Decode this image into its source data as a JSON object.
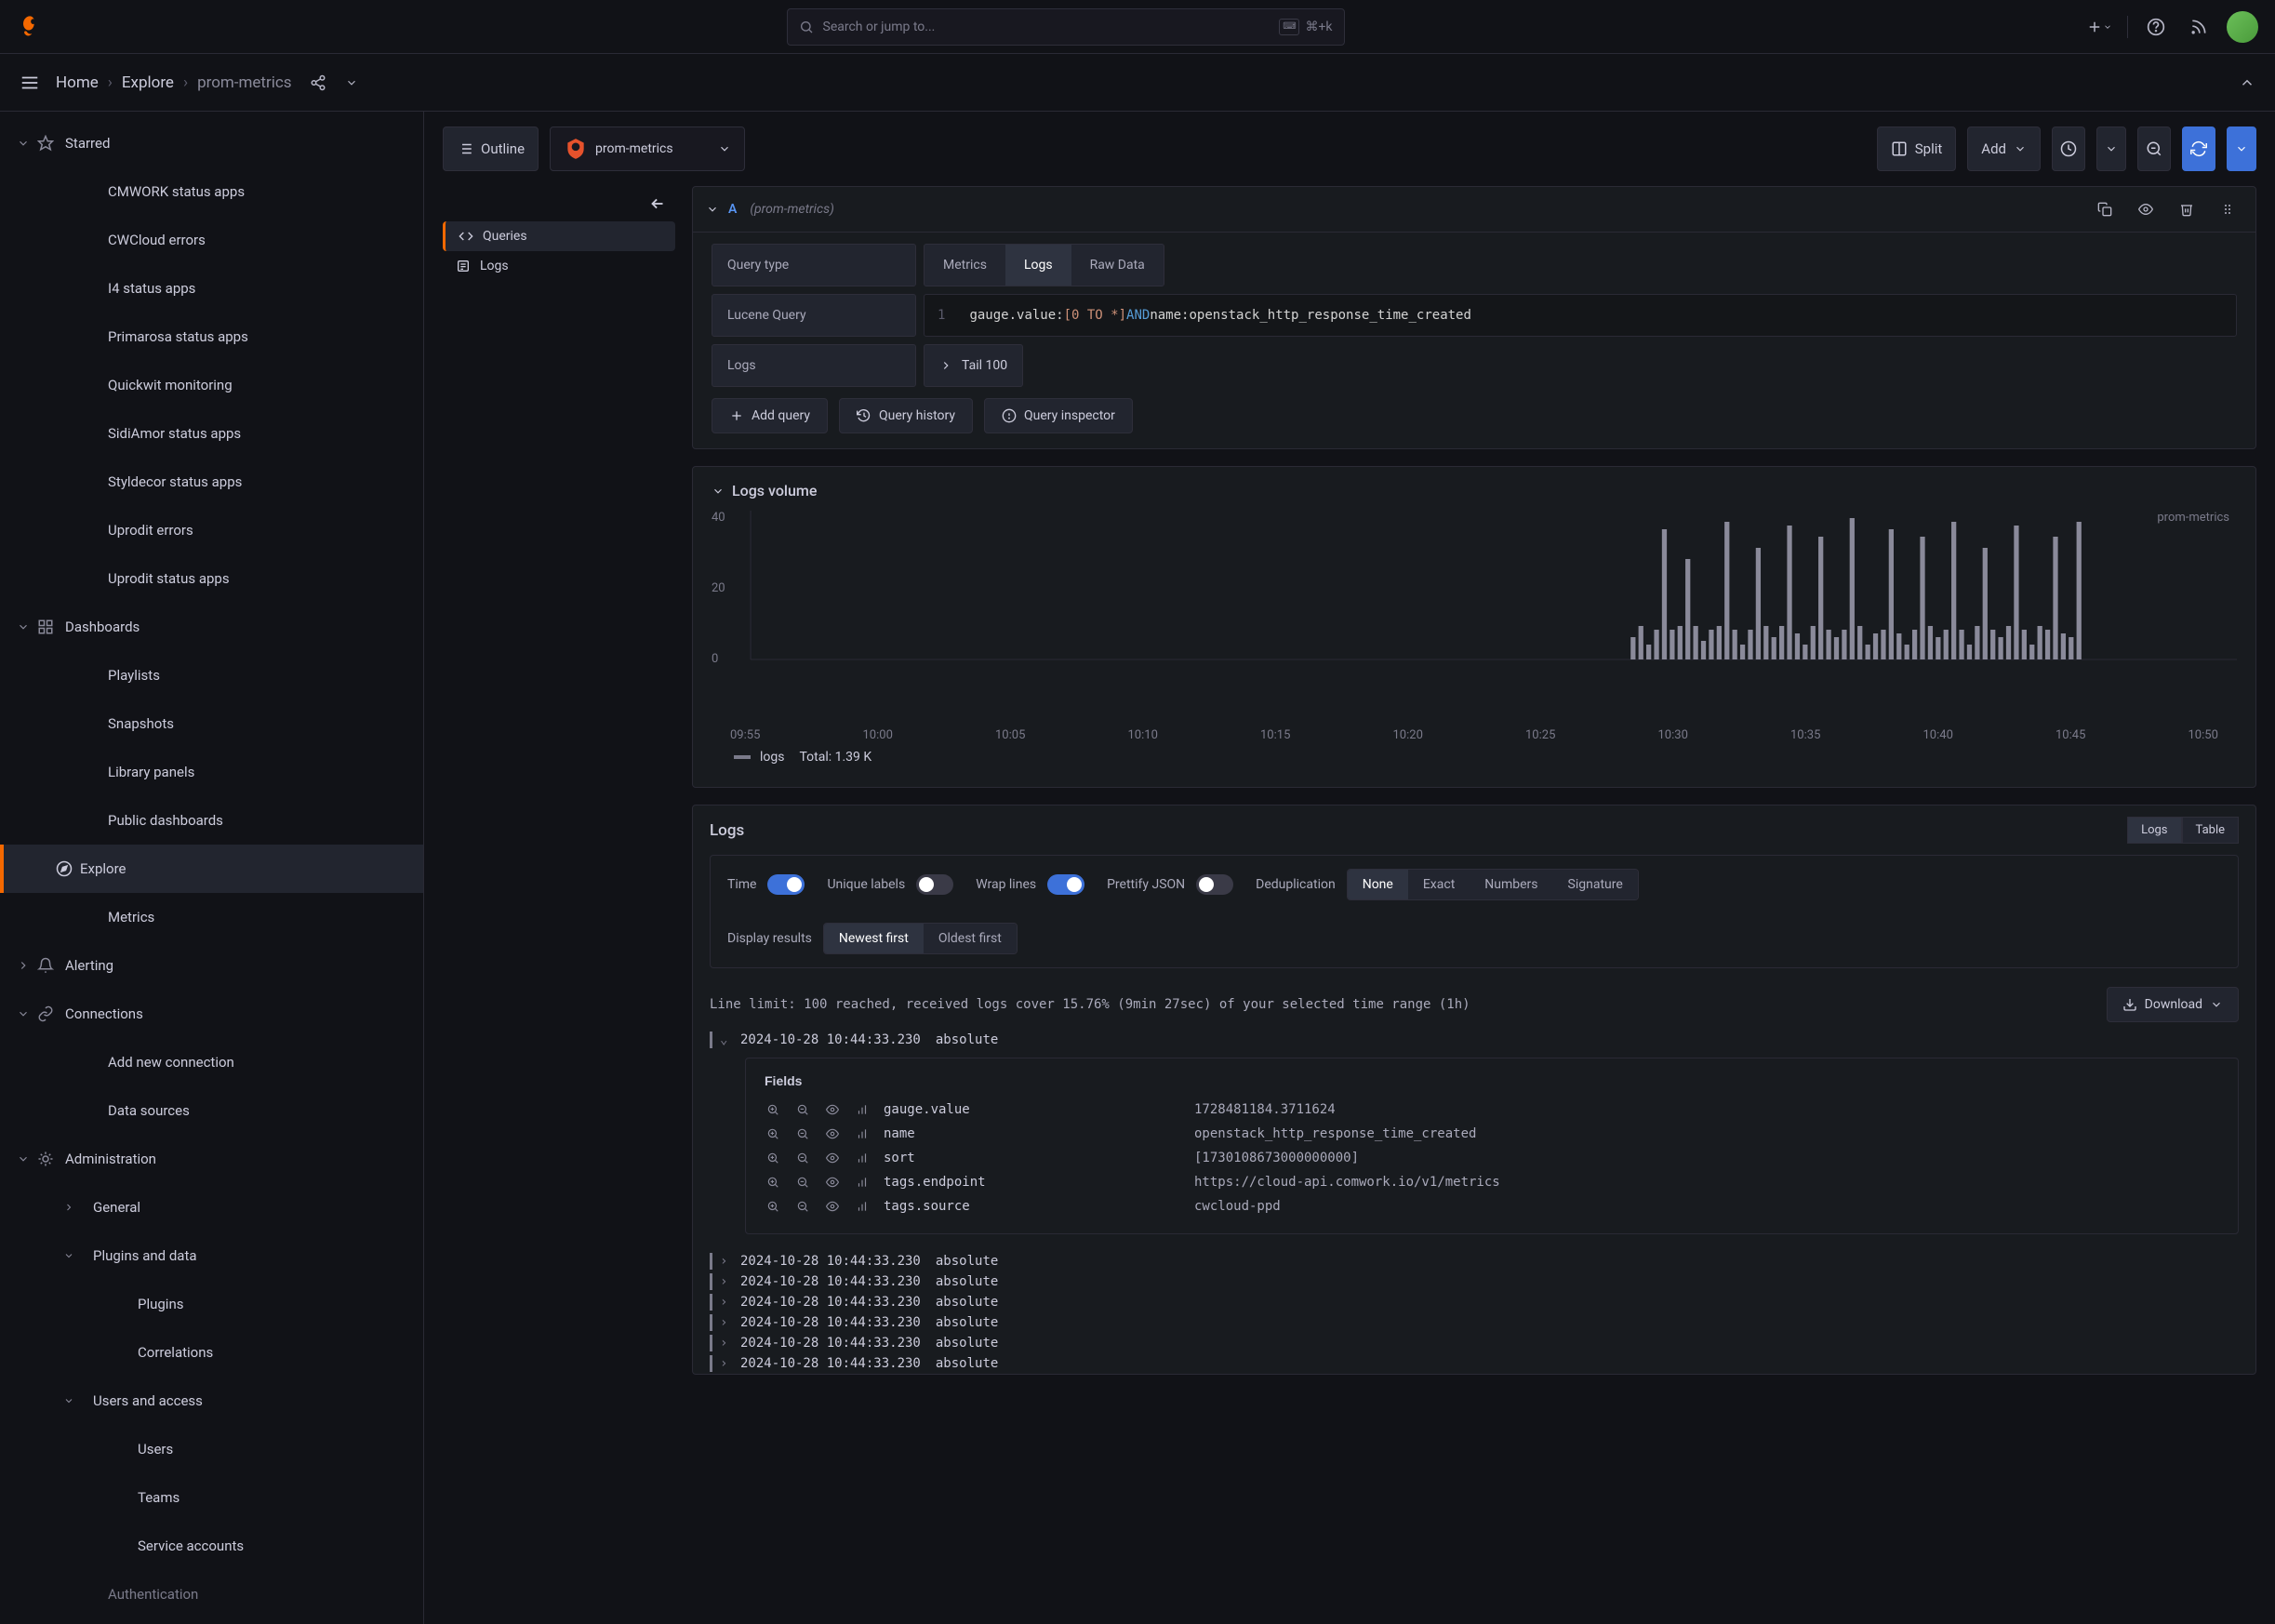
{
  "top": {
    "search_placeholder": "Search or jump to...",
    "kbd_shortcut": "⌘+k"
  },
  "breadcrumb": {
    "home": "Home",
    "explore": "Explore",
    "current": "prom-metrics"
  },
  "sidebar": {
    "starred": "Starred",
    "starred_items": [
      "CMWORK status apps",
      "CWCloud errors",
      "I4 status apps",
      "Primarosa status apps",
      "Quickwit monitoring",
      "SidiAmor status apps",
      "Styldecor status apps",
      "Uprodit errors",
      "Uprodit status apps"
    ],
    "dashboards": "Dashboards",
    "dashboards_items": [
      "Playlists",
      "Snapshots",
      "Library panels",
      "Public dashboards"
    ],
    "explore": "Explore",
    "explore_items": [
      "Metrics"
    ],
    "alerting": "Alerting",
    "connections": "Connections",
    "connections_items": [
      "Add new connection",
      "Data sources"
    ],
    "administration": "Administration",
    "admin_items": {
      "general": "General",
      "plugins": "Plugins and data",
      "plugins_children": [
        "Plugins",
        "Correlations"
      ],
      "users": "Users and access",
      "users_children": [
        "Users",
        "Teams",
        "Service accounts"
      ],
      "auth": "Authentication"
    }
  },
  "toolbar": {
    "outline": "Outline",
    "datasource": "prom-metrics",
    "split": "Split",
    "add": "Add"
  },
  "explore_tree": {
    "queries": "Queries",
    "logs": "Logs"
  },
  "query": {
    "letter": "A",
    "source": "(prom-metrics)",
    "type_label": "Query type",
    "types": [
      "Metrics",
      "Logs",
      "Raw Data"
    ],
    "lucene_label": "Lucene Query",
    "lucene_line": "1",
    "lucene_code_parts": {
      "p1": "gauge.value:",
      "p2": "[0 TO *]",
      "p3": " AND ",
      "p4": "name:openstack_http_response_time_created"
    },
    "logs_label": "Logs",
    "tail": "Tail 100"
  },
  "actions": {
    "add_query": "Add query",
    "history": "Query history",
    "inspector": "Query inspector"
  },
  "volume": {
    "title": "Logs volume",
    "legend": "logs",
    "total": "Total: 1.39 K",
    "series_label": "prom-metrics"
  },
  "chart_data": {
    "type": "bar",
    "title": "Logs volume",
    "ylabel": "",
    "ylim": [
      0,
      40
    ],
    "y_ticks": [
      0,
      20,
      40
    ],
    "categories": [
      "09:55",
      "10:00",
      "10:05",
      "10:10",
      "10:15",
      "10:20",
      "10:25",
      "10:30",
      "10:35",
      "10:40",
      "10:45",
      "10:50"
    ],
    "series": [
      {
        "name": "logs",
        "values_by_tick_segment": {
          "09:55-10:25": [],
          "10:28": [
            6,
            9,
            4,
            8,
            35,
            8,
            9,
            27,
            9,
            5,
            8,
            9,
            37,
            8,
            4,
            8,
            30,
            9,
            6,
            9,
            36,
            7,
            4,
            9,
            33,
            8,
            6,
            8,
            38,
            9,
            4,
            7,
            8,
            35,
            7,
            4,
            8,
            33,
            9,
            6,
            8,
            37,
            8,
            4,
            9,
            30,
            8,
            6,
            9,
            36,
            8,
            4,
            9,
            8,
            33,
            7,
            6,
            37
          ],
          "10:46-10:50": []
        }
      }
    ],
    "total": 1390
  },
  "logs_section": {
    "title": "Logs",
    "tabs": [
      "Logs",
      "Table"
    ],
    "opts": {
      "time": "Time",
      "unique": "Unique labels",
      "wrap": "Wrap lines",
      "prettify": "Prettify JSON",
      "dedup": "Deduplication",
      "dedup_options": [
        "None",
        "Exact",
        "Numbers",
        "Signature"
      ],
      "display": "Display results",
      "display_options": [
        "Newest first",
        "Oldest first"
      ]
    },
    "limit_text": "Line limit: 100 reached, received logs cover 15.76% (9min 27sec) of your selected time range (1h)",
    "download": "Download",
    "entries": [
      {
        "ts": "2024-10-28 10:44:33.230",
        "msg": "absolute",
        "expanded": true
      },
      {
        "ts": "2024-10-28 10:44:33.230",
        "msg": "absolute",
        "expanded": false
      },
      {
        "ts": "2024-10-28 10:44:33.230",
        "msg": "absolute",
        "expanded": false
      },
      {
        "ts": "2024-10-28 10:44:33.230",
        "msg": "absolute",
        "expanded": false
      },
      {
        "ts": "2024-10-28 10:44:33.230",
        "msg": "absolute",
        "expanded": false
      },
      {
        "ts": "2024-10-28 10:44:33.230",
        "msg": "absolute",
        "expanded": false
      },
      {
        "ts": "2024-10-28 10:44:33.230",
        "msg": "absolute",
        "expanded": false
      }
    ],
    "fields_header": "Fields",
    "fields": [
      {
        "name": "gauge.value",
        "value": "1728481184.3711624"
      },
      {
        "name": "name",
        "value": "openstack_http_response_time_created"
      },
      {
        "name": "sort",
        "value": "[1730108673000000000]"
      },
      {
        "name": "tags.endpoint",
        "value": "https://cloud-api.comwork.io/v1/metrics"
      },
      {
        "name": "tags.source",
        "value": "cwcloud-ppd"
      }
    ]
  }
}
